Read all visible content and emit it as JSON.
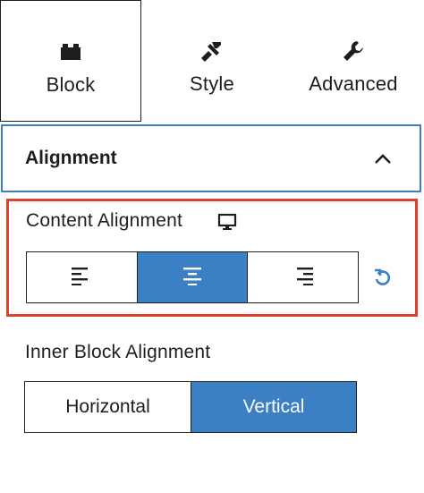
{
  "tabs": [
    {
      "label": "Block",
      "icon": "block-icon",
      "selected": true
    },
    {
      "label": "Style",
      "icon": "brush-icon",
      "selected": false
    },
    {
      "label": "Advanced",
      "icon": "wrench-icon",
      "selected": false
    }
  ],
  "panel": {
    "title": "Alignment",
    "icon": "chevron-up-icon",
    "expanded": true
  },
  "content_alignment": {
    "label": "Content Alignment",
    "device_icon": "desktop-monitor-icon",
    "options": [
      {
        "name": "align-left",
        "icon": "align-left-icon",
        "active": false
      },
      {
        "name": "align-center",
        "icon": "align-center-icon",
        "active": true
      },
      {
        "name": "align-right",
        "icon": "align-right-icon",
        "active": false
      }
    ],
    "reset_icon": "reset-icon"
  },
  "inner_block_alignment": {
    "label": "Inner Block Alignment",
    "options": [
      {
        "label": "Horizontal",
        "active": false
      },
      {
        "label": "Vertical",
        "active": true
      }
    ]
  },
  "colors": {
    "accent": "#3b7fc4",
    "highlight_border": "#e0432d",
    "text": "#1e1e1e"
  }
}
